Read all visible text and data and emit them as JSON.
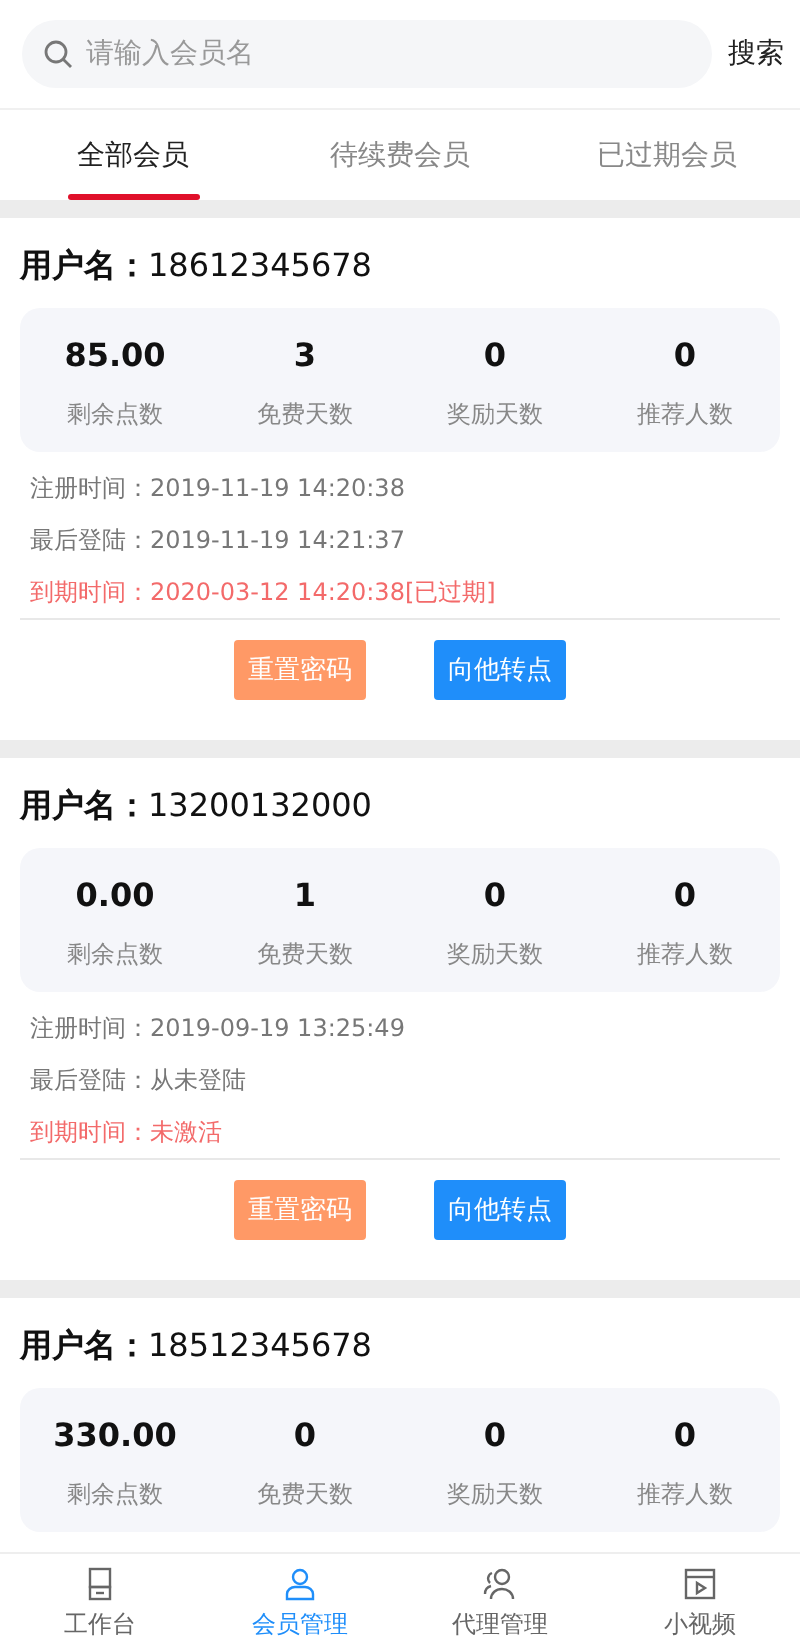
{
  "search": {
    "placeholder": "请输入会员名",
    "button": "搜索"
  },
  "tabs": [
    {
      "label": "全部会员",
      "selected": true
    },
    {
      "label": "待续费会员",
      "selected": false
    },
    {
      "label": "已过期会员",
      "selected": false
    }
  ],
  "members": [
    {
      "label": "用户名：",
      "username": "18612345678",
      "stats": [
        {
          "value": "85.00",
          "label": "剩余点数"
        },
        {
          "value": "3",
          "label": "免费天数"
        },
        {
          "value": "0",
          "label": "奖励天数"
        },
        {
          "value": "0",
          "label": "推荐人数"
        }
      ],
      "info": [
        {
          "text": "注册时间：2019-11-19 14:20:38",
          "warning": false
        },
        {
          "text": "最后登陆：2019-11-19 14:21:37",
          "warning": false
        },
        {
          "text": "到期时间：2020-03-12 14:20:38[已过期]",
          "warning": true
        }
      ],
      "buttons": [
        {
          "label": "重置密码",
          "kind": "reset"
        },
        {
          "label": "向他转点",
          "kind": "transfer"
        }
      ]
    },
    {
      "label": "用户名：",
      "username": "13200132000",
      "stats": [
        {
          "value": "0.00",
          "label": "剩余点数"
        },
        {
          "value": "1",
          "label": "免费天数"
        },
        {
          "value": "0",
          "label": "奖励天数"
        },
        {
          "value": "0",
          "label": "推荐人数"
        }
      ],
      "info": [
        {
          "text": "注册时间：2019-09-19 13:25:49",
          "warning": false
        },
        {
          "text": "最后登陆：从未登陆",
          "warning": false
        },
        {
          "text": "到期时间：未激活",
          "warning": true
        }
      ],
      "buttons": [
        {
          "label": "重置密码",
          "kind": "reset"
        },
        {
          "label": "向他转点",
          "kind": "transfer"
        }
      ]
    },
    {
      "label": "用户名：",
      "username": "18512345678",
      "stats": [
        {
          "value": "330.00",
          "label": "剩余点数"
        },
        {
          "value": "0",
          "label": "免费天数"
        },
        {
          "value": "0",
          "label": "奖励天数"
        },
        {
          "value": "0",
          "label": "推荐人数"
        }
      ]
    }
  ],
  "nav": [
    {
      "label": "工作台",
      "kind": "desk",
      "selected": false
    },
    {
      "label": "会员管理",
      "kind": "member",
      "selected": true
    },
    {
      "label": "代理管理",
      "kind": "agent",
      "selected": false
    },
    {
      "label": "小视频",
      "kind": "video",
      "selected": false
    }
  ]
}
